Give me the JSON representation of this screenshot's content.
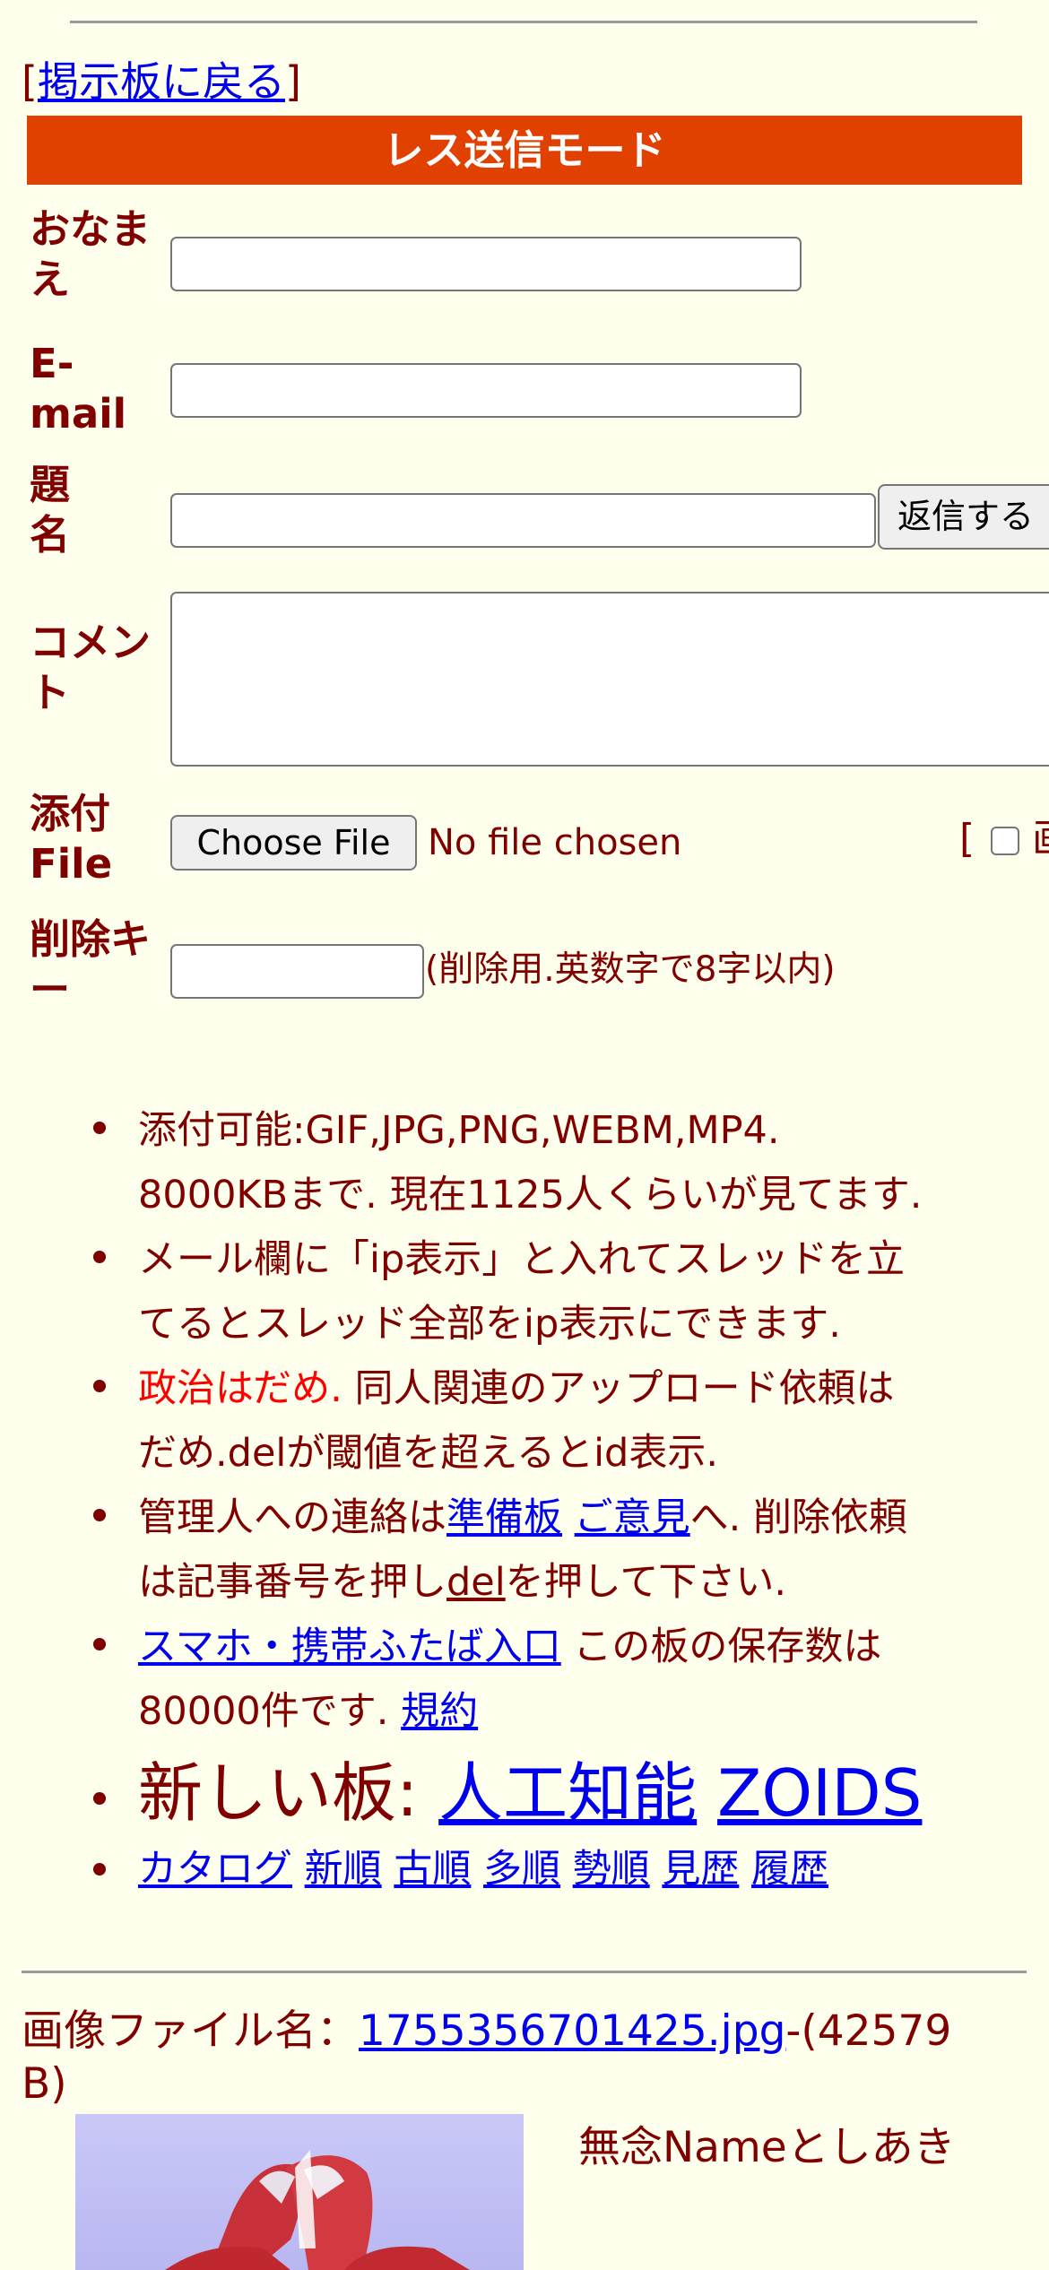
{
  "nav": {
    "bracket_open": "[",
    "back_label": "掲示板に戻る",
    "bracket_close": "]"
  },
  "form": {
    "title": "レス送信モード",
    "name_label": "おなまえ",
    "email_label": "E-mail",
    "subject_label": "題名",
    "submit_label": "返信する",
    "comment_label": "コメント",
    "file_label": "添付File",
    "choose_file_label": "Choose File",
    "no_file_text": "No file chosen",
    "image_option_bracket": "[",
    "image_option_partial": "画",
    "delete_key_label": "削除キー",
    "delete_key_note": "(削除用.英数字で8字以内)"
  },
  "info": {
    "item1_line1": "添付可能:GIF,JPG,PNG,WEBM,MP4.",
    "item1_line2": "8000KBまで. 現在1125人くらいが見てます.",
    "item2_line1": "メール欄に「ip表示」と入れてスレッドを立",
    "item2_line2": "てるとスレッド全部をip表示にできます.",
    "item3_red": "政治はだめ.",
    "item3_line1_rest": " 同人関連のアップロード依頼は",
    "item3_line2": "だめ.delが閾値を超えるとid表示.",
    "item4_text1": "管理人への連絡は",
    "item4_link1": "準備板",
    "item4_space": " ",
    "item4_link2": "ご意見",
    "item4_text2": "へ. 削除依頼",
    "item4_line2_text1": "は記事番号を押し",
    "item4_link3": "del",
    "item4_line2_text2": "を押して下さい.",
    "item5_link": "スマホ・携帯ふたば入口",
    "item5_text1": " この板の保存数は",
    "item5_line2_text": "80000件です. ",
    "item5_link2": "規約",
    "item6_text": "新しい板: ",
    "item6_link1": "人工知能",
    "item6_link2": "ZOIDS",
    "catalog_links": [
      "カタログ",
      "新順",
      "古順",
      "多順",
      "勢順",
      "見歴",
      "履歴"
    ]
  },
  "post": {
    "file_label": "画像ファイル名：",
    "file_name": "1755356701425.jpg",
    "file_size": "-(42579",
    "file_size_unit": "B)",
    "poster_name": "無念Nameとしあき"
  }
}
